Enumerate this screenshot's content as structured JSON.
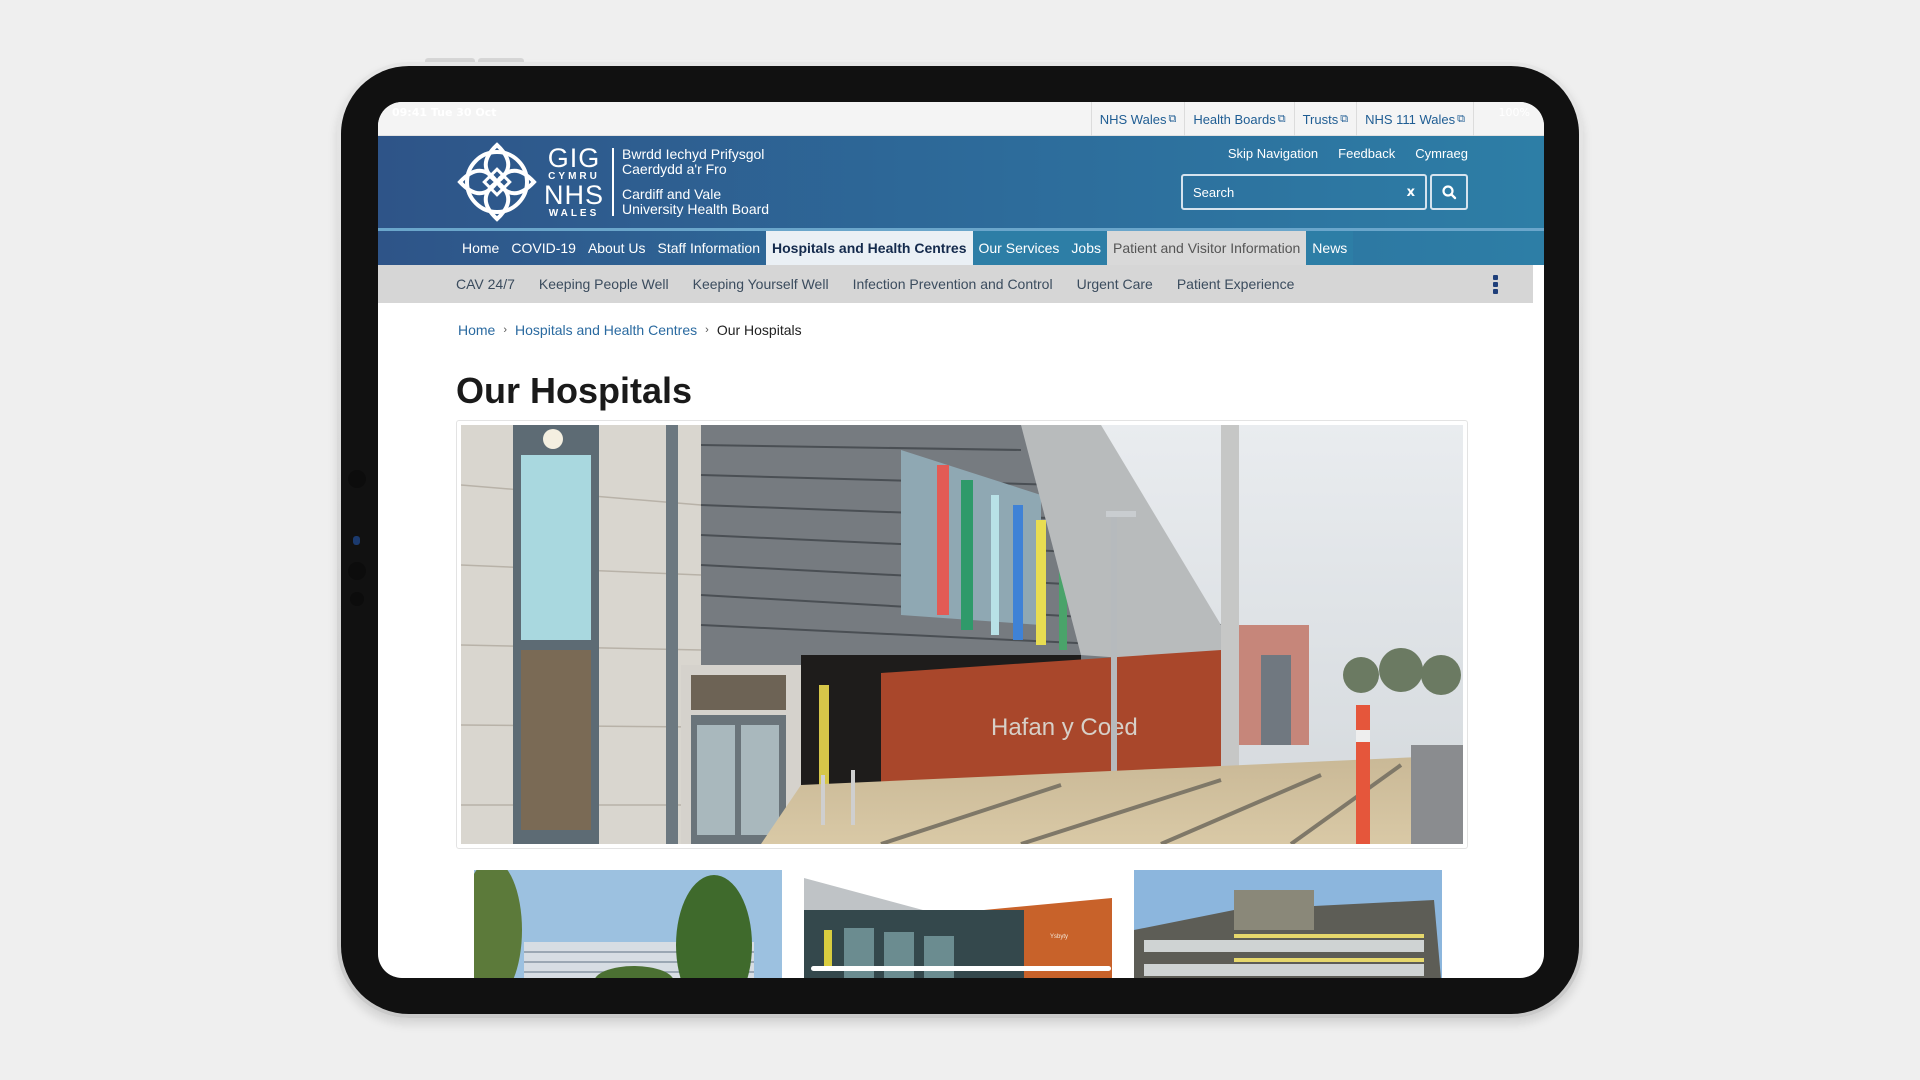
{
  "device": {
    "status_time": "09:41  Tue 30 Oct",
    "battery": "100%"
  },
  "utility_links": [
    {
      "label": "NHS Wales",
      "icon": "external-link-icon"
    },
    {
      "label": "Health Boards",
      "icon": "external-link-icon"
    },
    {
      "label": "Trusts",
      "icon": "external-link-icon"
    },
    {
      "label": "NHS 111 Wales",
      "icon": "external-link-icon"
    }
  ],
  "header": {
    "logo": {
      "gig": "GIG",
      "cymru": "CYMRU",
      "nhs": "NHS",
      "wales": "WALES",
      "welsh_line1": "Bwrdd Iechyd Prifysgol",
      "welsh_line2": "Caerdydd a'r Fro",
      "english_line1": "Cardiff and Vale",
      "english_line2": "University Health Board"
    },
    "links": [
      "Skip Navigation",
      "Feedback",
      "Cymraeg"
    ],
    "search": {
      "placeholder": "Search",
      "clear_label": "x",
      "button_icon": "search-icon"
    }
  },
  "nav": {
    "items": [
      "Home",
      "COVID-19",
      "About Us",
      "Staff Information",
      "Hospitals and Health Centres",
      "Our Services",
      "Jobs",
      "Patient and Visitor Information",
      "News"
    ],
    "active": "Hospitals and Health Centres"
  },
  "subnav": {
    "items": [
      "CAV 24/7",
      "Keeping People Well",
      "Keeping Yourself Well",
      "Infection Prevention and Control",
      "Urgent Care",
      "Patient Experience"
    ],
    "more_icon": "kebab-menu-icon"
  },
  "breadcrumb": {
    "items": [
      "Home",
      "Hospitals and Health Centres"
    ],
    "current": "Our Hospitals",
    "separator": "›"
  },
  "page": {
    "title": "Our Hospitals",
    "hero_sign": "Hafan y Coed"
  },
  "colors": {
    "header_start": "#2e5488",
    "header_end": "#2d7ea6",
    "link": "#2a6aa0",
    "subnav_bg": "#d6d6d6",
    "active_tab_bg": "#eaf0f5"
  }
}
